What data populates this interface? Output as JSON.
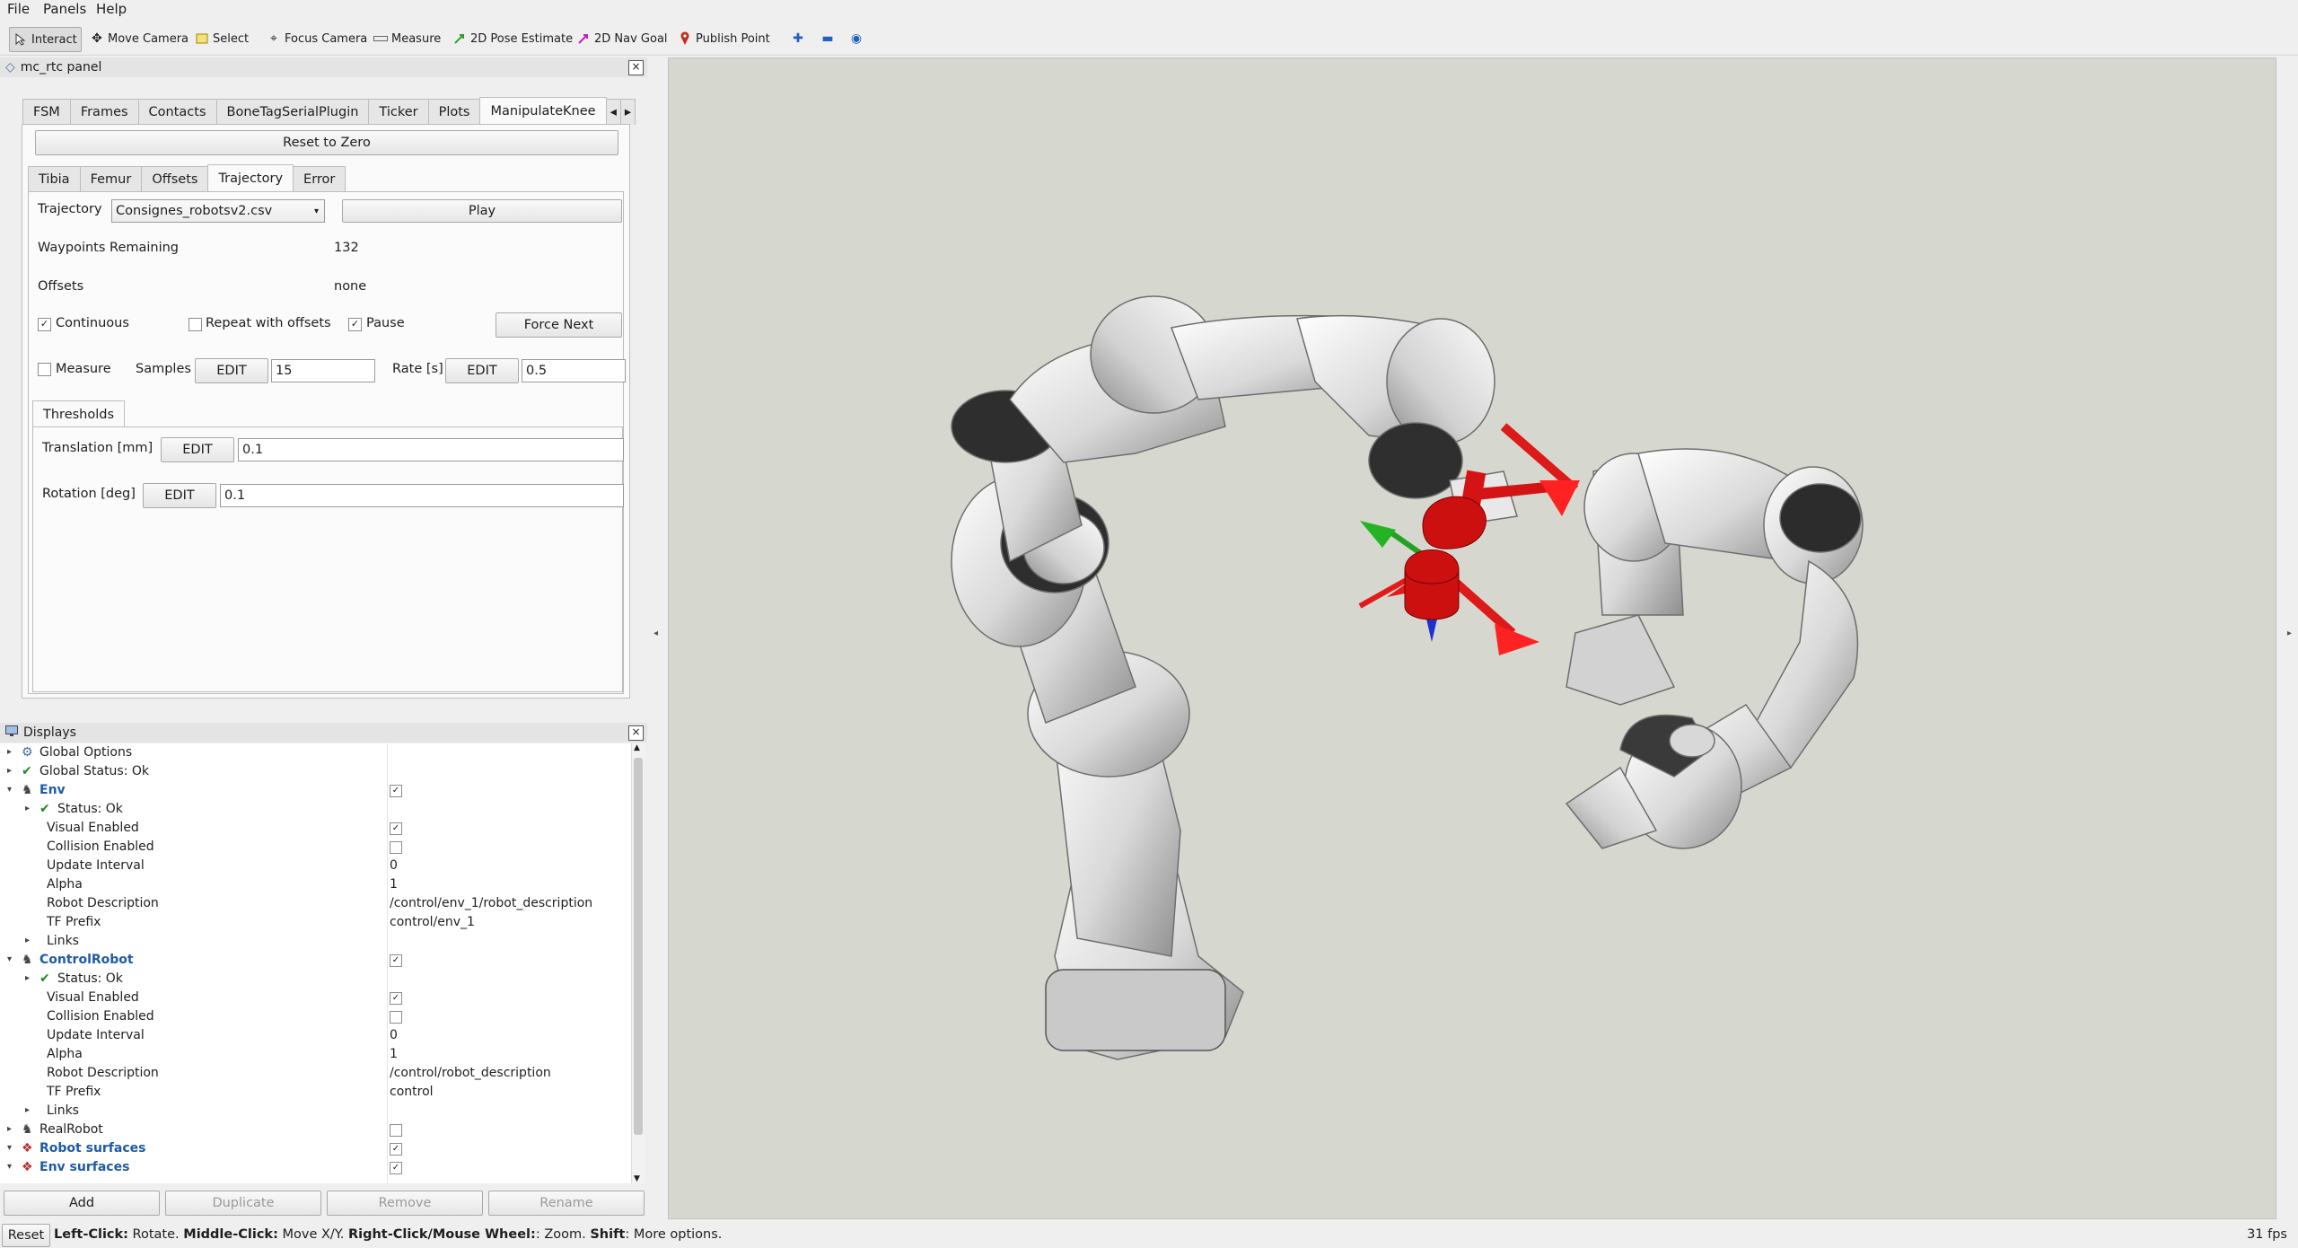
{
  "menu": {
    "items": [
      "File",
      "Panels",
      "Help"
    ]
  },
  "toolbar": {
    "tools": [
      {
        "label": "Interact",
        "icon": "cursor-icon",
        "color": "#333333"
      },
      {
        "label": "Move Camera",
        "icon": "move-camera-icon",
        "color": "#555555"
      },
      {
        "label": "Select",
        "icon": "select-icon",
        "color": "#c8a200"
      },
      {
        "label": "Focus Camera",
        "icon": "focus-camera-icon",
        "color": "#555555"
      },
      {
        "label": "Measure",
        "icon": "ruler-icon",
        "color": "#666666"
      },
      {
        "label": "2D Pose Estimate",
        "icon": "pose-estimate-icon",
        "color": "#2aa02a"
      },
      {
        "label": "2D Nav Goal",
        "icon": "nav-goal-icon",
        "color": "#c020c0"
      },
      {
        "label": "Publish Point",
        "icon": "publish-point-icon",
        "color": "#c03020"
      }
    ]
  },
  "panel": {
    "title": "mc_rtc panel",
    "tabs": [
      "FSM",
      "Frames",
      "Contacts",
      "BoneTagSerialPlugin",
      "Ticker",
      "Plots",
      "ManipulateKnee"
    ],
    "selected_tab": "ManipulateKnee",
    "reset_button": "Reset to Zero",
    "subtabs": [
      "Tibia",
      "Femur",
      "Offsets",
      "Trajectory",
      "Error"
    ],
    "selected_subtab": "Trajectory",
    "trajectory": {
      "label": "Trajectory",
      "selected": "Consignes_robotsv2.csv",
      "play_button": "Play",
      "waypoints_label": "Waypoints Remaining",
      "waypoints_value": "132",
      "offsets_label": "Offsets",
      "offsets_value": "none",
      "continuous_label": "Continuous",
      "continuous_checked": true,
      "repeat_label": "Repeat with offsets",
      "repeat_checked": false,
      "pause_label": "Pause",
      "pause_checked": true,
      "force_next_button": "Force Next",
      "measure_label": "Measure",
      "measure_checked": false,
      "samples_label": "Samples",
      "samples_edit": "EDIT",
      "samples_value": "15",
      "rate_label": "Rate [s]",
      "rate_edit": "EDIT",
      "rate_value": "0.5"
    },
    "thresholds": {
      "tab": "Thresholds",
      "translation_label": "Translation [mm]",
      "translation_edit": "EDIT",
      "translation_value": "0.1",
      "rotation_label": "Rotation [deg]",
      "rotation_edit": "EDIT",
      "rotation_value": "0.1"
    }
  },
  "displays": {
    "title": "Displays",
    "rows": [
      {
        "name": "Global Options",
        "icon": "gear-icon",
        "value": "",
        "check": null,
        "indent": 0,
        "arrow": true,
        "bold": false
      },
      {
        "name": "Global Status: Ok",
        "icon": "check-icon",
        "value": "",
        "check": null,
        "indent": 0,
        "arrow": true,
        "bold": false
      },
      {
        "name": "Env",
        "icon": "robot-model-icon",
        "value": "",
        "check": true,
        "indent": 0,
        "arrow": true,
        "bold": true
      },
      {
        "name": "Status: Ok",
        "icon": "check-icon",
        "value": "",
        "check": null,
        "indent": 1,
        "arrow": true,
        "bold": false
      },
      {
        "name": "Visual Enabled",
        "icon": "",
        "value": "",
        "check": true,
        "indent": 1,
        "arrow": false,
        "bold": false
      },
      {
        "name": "Collision Enabled",
        "icon": "",
        "value": "",
        "check": false,
        "indent": 1,
        "arrow": false,
        "bold": false
      },
      {
        "name": "Update Interval",
        "icon": "",
        "value": "0",
        "check": null,
        "indent": 1,
        "arrow": false,
        "bold": false
      },
      {
        "name": "Alpha",
        "icon": "",
        "value": "1",
        "check": null,
        "indent": 1,
        "arrow": false,
        "bold": false
      },
      {
        "name": "Robot Description",
        "icon": "",
        "value": "/control/env_1/robot_description",
        "check": null,
        "indent": 1,
        "arrow": false,
        "bold": false
      },
      {
        "name": "TF Prefix",
        "icon": "",
        "value": "control/env_1",
        "check": null,
        "indent": 1,
        "arrow": false,
        "bold": false
      },
      {
        "name": "Links",
        "icon": "",
        "value": "",
        "check": null,
        "indent": 1,
        "arrow": true,
        "bold": false
      },
      {
        "name": "ControlRobot",
        "icon": "robot-model-icon",
        "value": "",
        "check": true,
        "indent": 0,
        "arrow": true,
        "bold": true
      },
      {
        "name": "Status: Ok",
        "icon": "check-icon",
        "value": "",
        "check": null,
        "indent": 1,
        "arrow": true,
        "bold": false
      },
      {
        "name": "Visual Enabled",
        "icon": "",
        "value": "",
        "check": true,
        "indent": 1,
        "arrow": false,
        "bold": false
      },
      {
        "name": "Collision Enabled",
        "icon": "",
        "value": "",
        "check": false,
        "indent": 1,
        "arrow": false,
        "bold": false
      },
      {
        "name": "Update Interval",
        "icon": "",
        "value": "0",
        "check": null,
        "indent": 1,
        "arrow": false,
        "bold": false
      },
      {
        "name": "Alpha",
        "icon": "",
        "value": "1",
        "check": null,
        "indent": 1,
        "arrow": false,
        "bold": false
      },
      {
        "name": "Robot Description",
        "icon": "",
        "value": "/control/robot_description",
        "check": null,
        "indent": 1,
        "arrow": false,
        "bold": false
      },
      {
        "name": "TF Prefix",
        "icon": "",
        "value": "control",
        "check": null,
        "indent": 1,
        "arrow": false,
        "bold": false
      },
      {
        "name": "Links",
        "icon": "",
        "value": "",
        "check": null,
        "indent": 1,
        "arrow": true,
        "bold": false
      },
      {
        "name": "RealRobot",
        "icon": "robot-model-icon",
        "value": "",
        "check": false,
        "indent": 0,
        "arrow": true,
        "bold": false
      },
      {
        "name": "Robot surfaces",
        "icon": "marker-array-icon",
        "value": "",
        "check": true,
        "indent": 0,
        "arrow": true,
        "bold": true
      },
      {
        "name": "Env surfaces",
        "icon": "marker-array-icon",
        "value": "",
        "check": true,
        "indent": 0,
        "arrow": true,
        "bold": true
      }
    ],
    "buttons": {
      "add": "Add",
      "duplicate": "Duplicate",
      "remove": "Remove",
      "rename": "Rename"
    }
  },
  "status": {
    "reset": "Reset",
    "hint_parts": [
      {
        "text": "Left-Click:",
        "bold": true
      },
      {
        "text": " Rotate. ",
        "bold": false
      },
      {
        "text": "Middle-Click:",
        "bold": true
      },
      {
        "text": " Move X/Y. ",
        "bold": false
      },
      {
        "text": "Right-Click/Mouse Wheel:",
        "bold": true
      },
      {
        "text": ": Zoom. ",
        "bold": false
      },
      {
        "text": "Shift",
        "bold": true
      },
      {
        "text": ": More options.",
        "bold": false
      }
    ],
    "fps": "31 fps"
  },
  "viewport": {
    "background": "#d6d7cf"
  }
}
